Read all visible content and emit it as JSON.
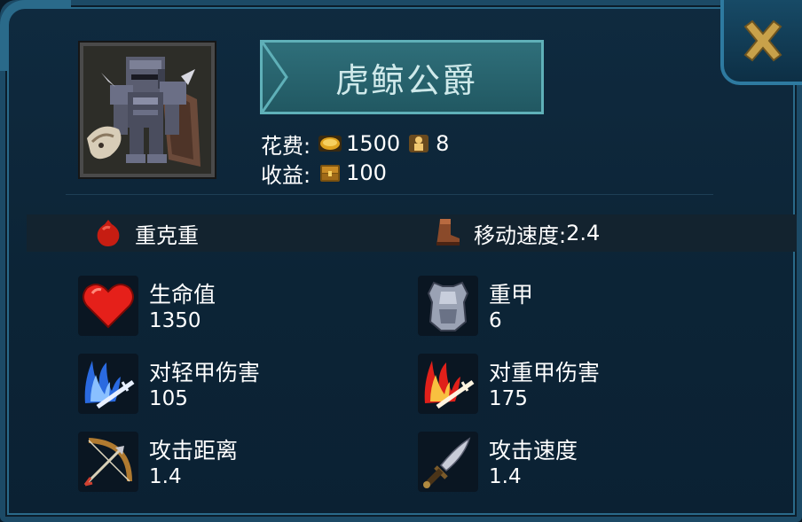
{
  "unit": {
    "name": "虎鲸公爵",
    "portrait_icon": "armored-knight-portrait",
    "cost_label": "花费:",
    "cost_gold": "1500",
    "cost_gold_icon": "gold-coin-icon",
    "cost_supply": "8",
    "cost_supply_icon": "population-icon",
    "income_label": "收益:",
    "income_value": "100",
    "income_icon": "treasure-chest-icon"
  },
  "traits": {
    "class_label": "重克重",
    "class_icon": "red-gem-icon",
    "move_label": "移动速度:",
    "move_value": "2.4",
    "move_icon": "boot-icon"
  },
  "stats": [
    {
      "name": "生命值",
      "value": "1350",
      "icon": "heart-icon"
    },
    {
      "name": "重甲",
      "value": "6",
      "icon": "armor-icon"
    },
    {
      "name": "对轻甲伤害",
      "value": "105",
      "icon": "blue-slash-icon"
    },
    {
      "name": "对重甲伤害",
      "value": "175",
      "icon": "fire-slash-icon"
    },
    {
      "name": "攻击距离",
      "value": "1.4",
      "icon": "bow-icon"
    },
    {
      "name": "攻击速度",
      "value": "1.4",
      "icon": "dagger-icon"
    }
  ],
  "colors": {
    "panel_bg": "#0c2436",
    "border": "#2a6a8a",
    "title_bg": "#2a6370",
    "title_text": "#cfe9ea",
    "close_x": "#c8a14a"
  }
}
